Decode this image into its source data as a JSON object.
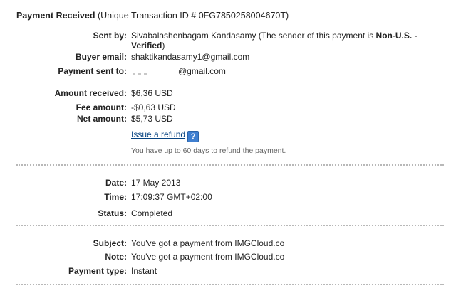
{
  "header": {
    "title_bold": "Payment Received",
    "title_rest": " (Unique Transaction ID # 0FG7850258004670T)"
  },
  "sender": {
    "label": "Sent by:",
    "name": "Sivabalashenbagam Kandasamy",
    "note_prefix": " (The sender of this payment is ",
    "note_bold": "Non-U.S. - Verified",
    "note_suffix": ")"
  },
  "buyer_email": {
    "label": "Buyer email:",
    "value": "shaktikandasamy1@gmail.com"
  },
  "payment_sent_to": {
    "label": "Payment sent to:",
    "value": "@gmail.com"
  },
  "amounts": {
    "received_label": "Amount received:",
    "received_value": "$6,36 USD",
    "fee_label": "Fee amount:",
    "fee_value": "-$0,63 USD",
    "net_label": "Net amount:",
    "net_value": "$5,73 USD"
  },
  "refund": {
    "link_label": "Issue a refund",
    "help_icon": "help-question-icon",
    "note": "You have up to 60 days to refund the payment."
  },
  "details": {
    "date_label": "Date:",
    "date_value": "17 May 2013",
    "time_label": "Time:",
    "time_value": "17:09:37 GMT+02:00",
    "status_label": "Status:",
    "status_value": "Completed"
  },
  "message": {
    "subject_label": "Subject:",
    "subject_value": "You've got a payment from IMGCloud.co",
    "note_label": "Note:",
    "note_value": "You've got a payment from IMGCloud.co",
    "type_label": "Payment type:",
    "type_value": "Instant"
  },
  "colors": {
    "link": "#084482",
    "help_icon_bg": "#3f7fd0",
    "divider": "#b8b8b8"
  }
}
